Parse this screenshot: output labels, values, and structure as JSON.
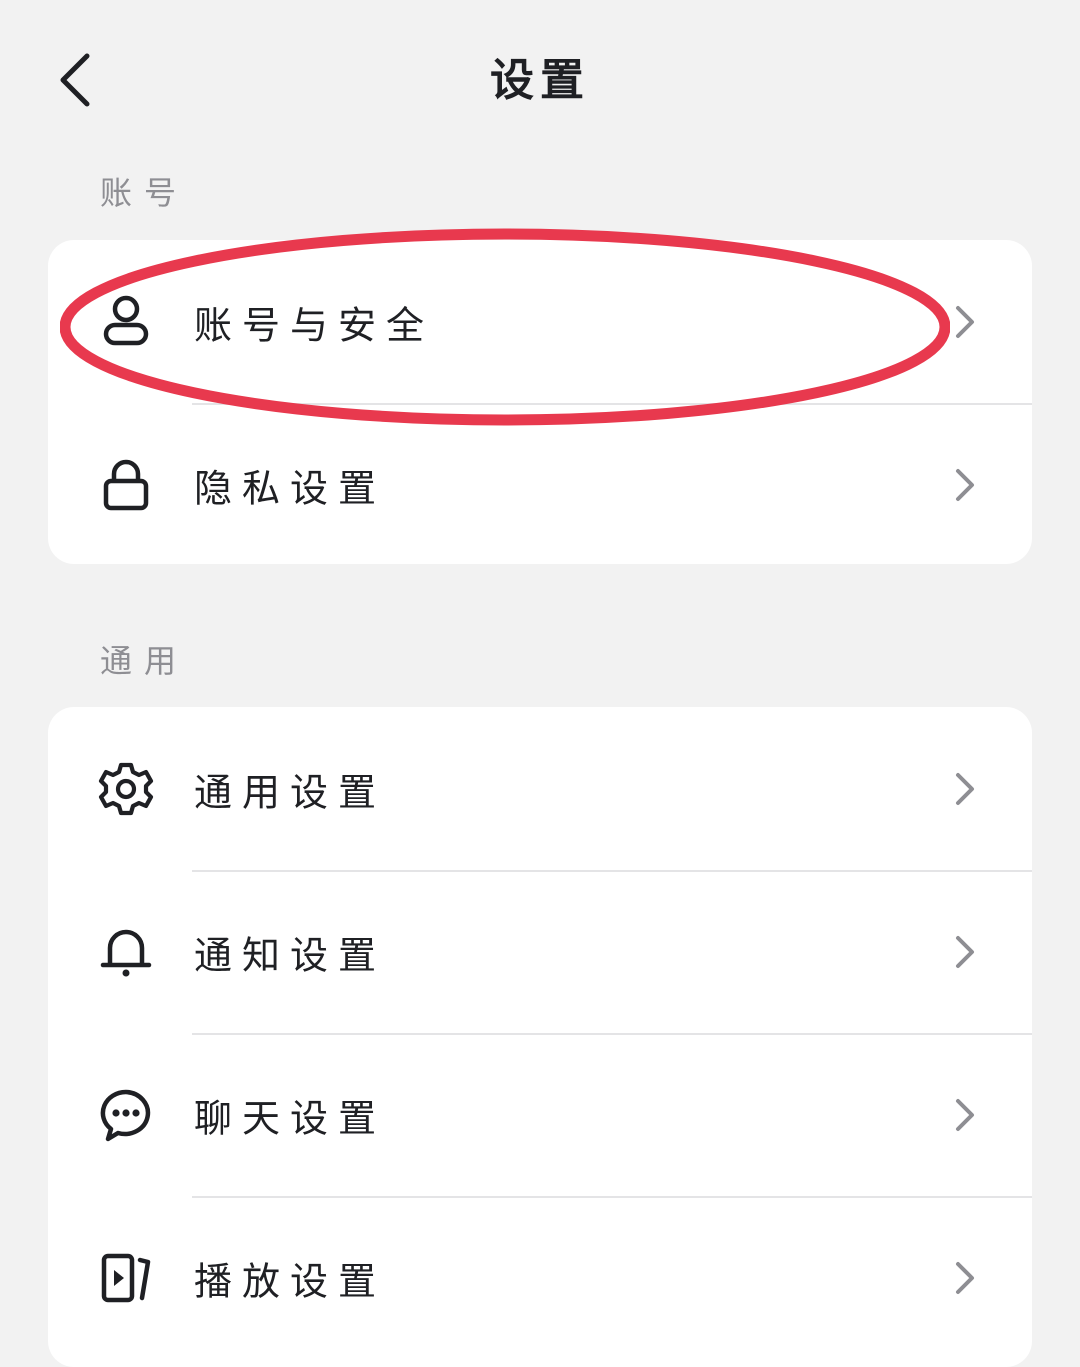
{
  "header": {
    "title": "设置",
    "back_icon": "chevron-left-icon"
  },
  "sections": [
    {
      "label": "账号",
      "items": [
        {
          "label": "账号与安全",
          "icon": "user-icon"
        },
        {
          "label": "隐私设置",
          "icon": "lock-icon"
        }
      ]
    },
    {
      "label": "通用",
      "items": [
        {
          "label": "通用设置",
          "icon": "gear-icon"
        },
        {
          "label": "通知设置",
          "icon": "bell-icon"
        },
        {
          "label": "聊天设置",
          "icon": "chat-bubble-icon"
        },
        {
          "label": "播放设置",
          "icon": "play-icon"
        }
      ]
    }
  ],
  "colors": {
    "background": "#f2f2f2",
    "card": "#ffffff",
    "text": "#1f2024",
    "section_label": "#8e8e93",
    "chevron": "#8e8e93",
    "highlight": "#e8394e"
  }
}
